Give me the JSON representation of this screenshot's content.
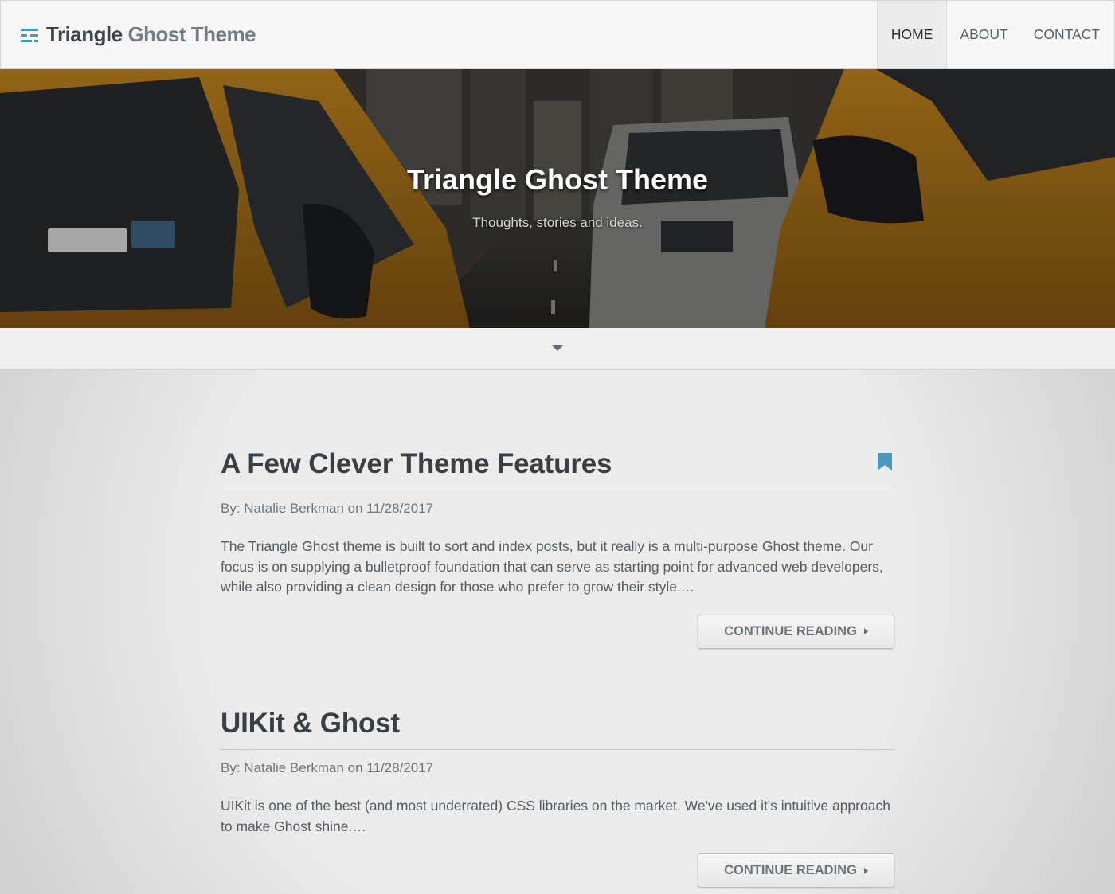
{
  "navbar": {
    "brand_part1": "Triangle",
    "brand_part2": "Ghost Theme",
    "links": [
      "HOME",
      "ABOUT",
      "CONTACT"
    ],
    "active": "HOME"
  },
  "hero": {
    "title": "Triangle Ghost Theme",
    "subtitle": "Thoughts, stories and ideas."
  },
  "colors": {
    "accent": "#4a97c2",
    "title": "#3a3f43",
    "meta": "#6f767b"
  },
  "posts": [
    {
      "title": "A Few Clever Theme Features",
      "meta": "By: Natalie Berkman on 11/28/2017",
      "excerpt": "The Triangle Ghost theme is built to sort and index posts, but it really is a multi-purpose Ghost theme. Our focus is on supplying a bulletproof foundation that can serve as starting point for advanced web developers, while also providing a clean design for those who prefer to grow their style.…",
      "featured": true,
      "button": "CONTINUE READING"
    },
    {
      "title": "UIKit & Ghost",
      "meta": "By: Natalie Berkman on 11/28/2017",
      "excerpt": "UIKit is one of the best (and most underrated) CSS libraries on the market. We've used it's intuitive approach to make Ghost shine.…",
      "featured": false,
      "button": "CONTINUE READING"
    }
  ]
}
